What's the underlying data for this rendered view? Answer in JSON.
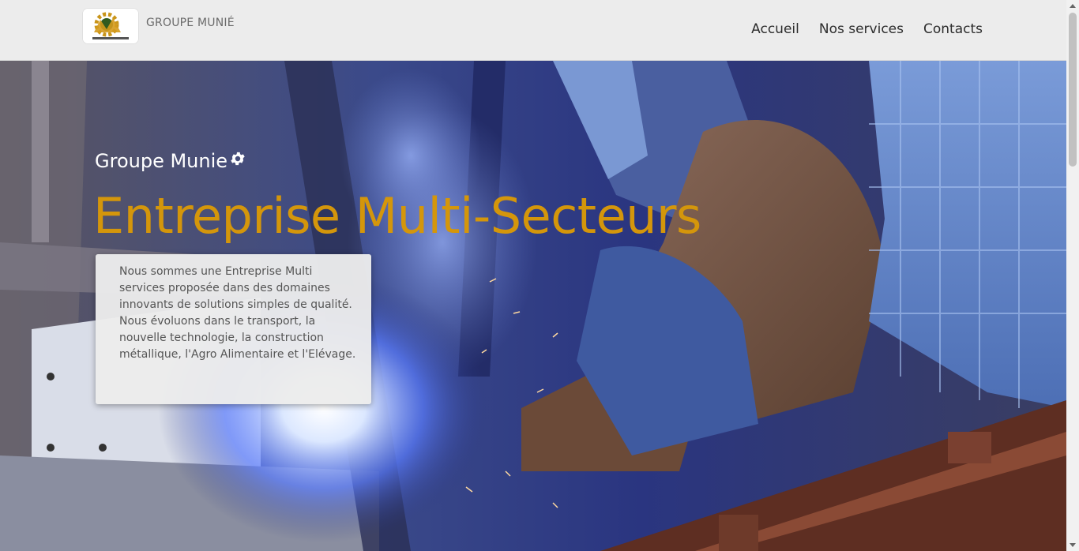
{
  "navbar": {
    "brand": "GROUPE MUNIÉ",
    "logo_icon": "gear-logo-icon",
    "links": [
      "Accueil",
      "Nos services",
      "Contacts"
    ]
  },
  "hero": {
    "subtitle": "Groupe Munie",
    "subtitle_icon": "gear-icon",
    "title": "Entreprise Multi-Secteurs",
    "intro_paragraph_1": "Nous sommes une Entreprise Multi services proposée dans des domaines innovants de solutions simples de qualité.",
    "intro_paragraph_2": "Nous évoluons dans le transport, la nouvelle technologie, la construction métallique, l'Agro Alimentaire et l'Elévage.",
    "background_image": "welder-at-work-image"
  },
  "colors": {
    "accent": "#d4960b",
    "navbar_bg": "#ececec",
    "card_bg": "#ececec"
  }
}
